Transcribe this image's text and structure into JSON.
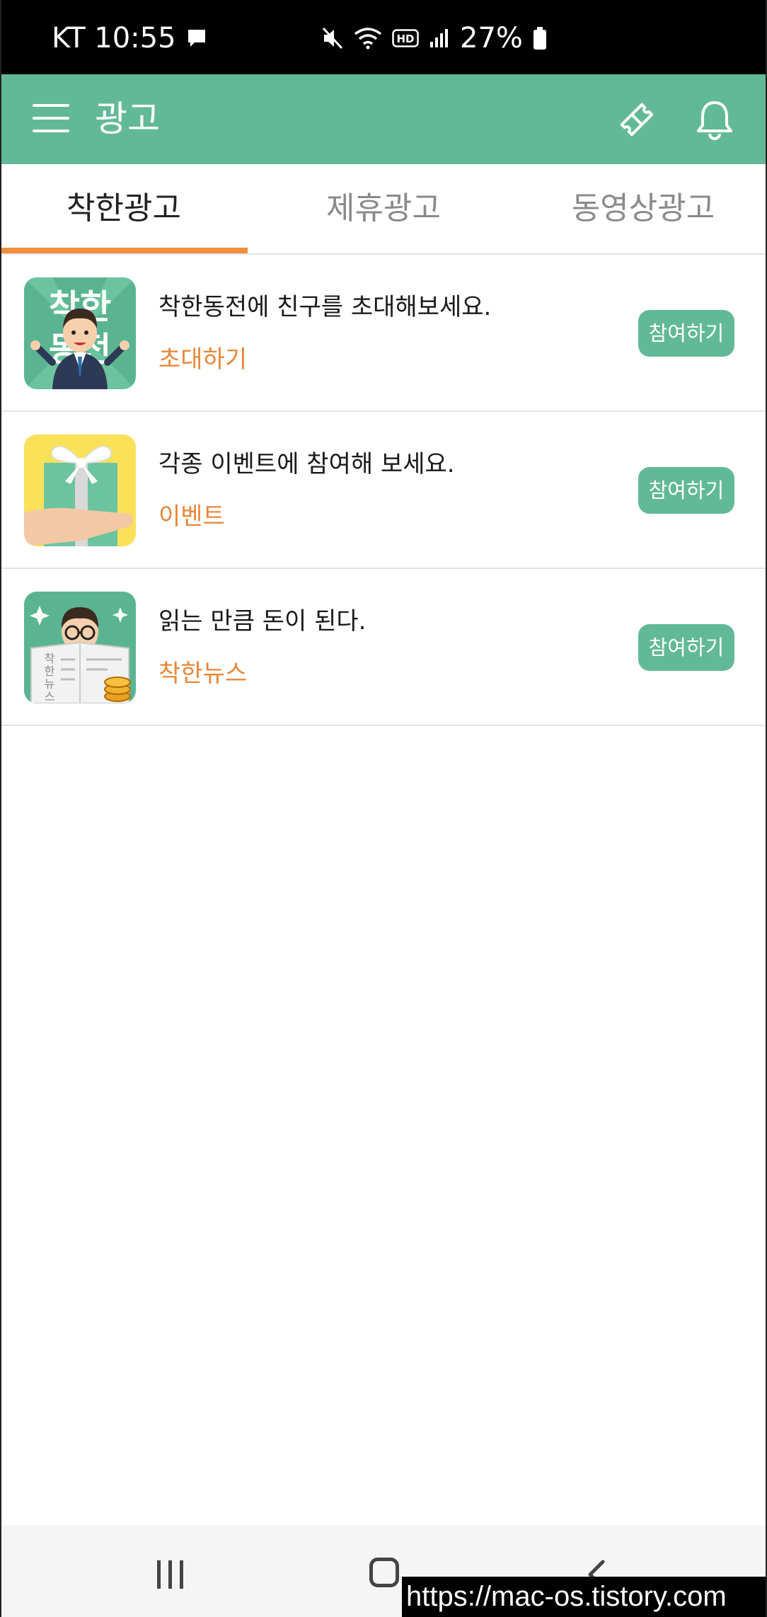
{
  "status_bar": {
    "carrier_time": "KT 10:55",
    "battery": "27%",
    "icons": [
      "message-icon",
      "mute-icon",
      "wifi-icon",
      "hd-icon",
      "signal-icon",
      "battery-icon"
    ]
  },
  "app_bar": {
    "title": "광고",
    "icons": [
      "menu-icon",
      "coupon-icon",
      "bell-icon"
    ]
  },
  "tabs": [
    {
      "label": "착한광고",
      "active": true
    },
    {
      "label": "제휴광고",
      "active": false
    },
    {
      "label": "동영상광고",
      "active": false
    }
  ],
  "colors": {
    "primary": "#62b998",
    "accent": "#ef8f3a",
    "subtitle": "#e8873a"
  },
  "list": [
    {
      "title": "착한동전에 친구를 초대해보세요.",
      "subtitle": "초대하기",
      "button": "참여하기",
      "thumb_text": "착한동전"
    },
    {
      "title": "각종 이벤트에 참여해 보세요.",
      "subtitle": "이벤트",
      "button": "참여하기"
    },
    {
      "title": "읽는 만큼 돈이 된다.",
      "subtitle": "착한뉴스",
      "button": "참여하기",
      "thumb_text": "착한뉴스"
    }
  ],
  "nav_bar": {
    "icons": [
      "recent-apps-icon",
      "home-icon",
      "back-icon"
    ]
  },
  "watermark": "https://mac-os.tistory.com"
}
